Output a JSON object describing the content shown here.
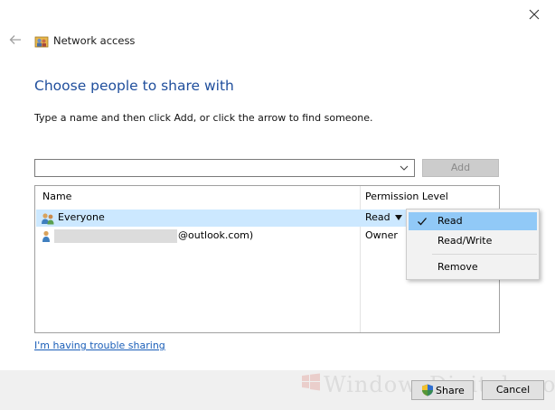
{
  "window": {
    "title": "Network access",
    "close_icon": "close-icon",
    "back_icon": "back-arrow-icon",
    "title_icon": "network-share-icon"
  },
  "main": {
    "heading": "Choose people to share with",
    "instruction": "Type a name and then click Add, or click the arrow to find someone.",
    "name_input": {
      "value": "",
      "placeholder": ""
    },
    "add_label": "Add"
  },
  "list": {
    "columns": {
      "name": "Name",
      "permission": "Permission Level"
    },
    "rows": [
      {
        "icon": "group-users-icon",
        "name": "Everyone",
        "permission": "Read",
        "selected": true
      },
      {
        "icon": "user-icon",
        "name_suffix": "@outlook.com)",
        "permission": "Owner",
        "selected": false
      }
    ]
  },
  "permission_menu": {
    "items": [
      {
        "label": "Read",
        "checked": true
      },
      {
        "label": "Read/Write",
        "checked": false
      },
      {
        "label": "Remove",
        "checked": false
      }
    ]
  },
  "help_link": "I'm having trouble sharing",
  "footer": {
    "share_label": "Share",
    "cancel_label": "Cancel"
  },
  "watermark": "WindowsDigitals.com",
  "colors": {
    "heading": "#1f4e9c",
    "link": "#1a5eb8",
    "row_selected": "#cce8ff",
    "menu_highlight": "#91c9f7",
    "footer_bg": "#f0f0f0"
  }
}
